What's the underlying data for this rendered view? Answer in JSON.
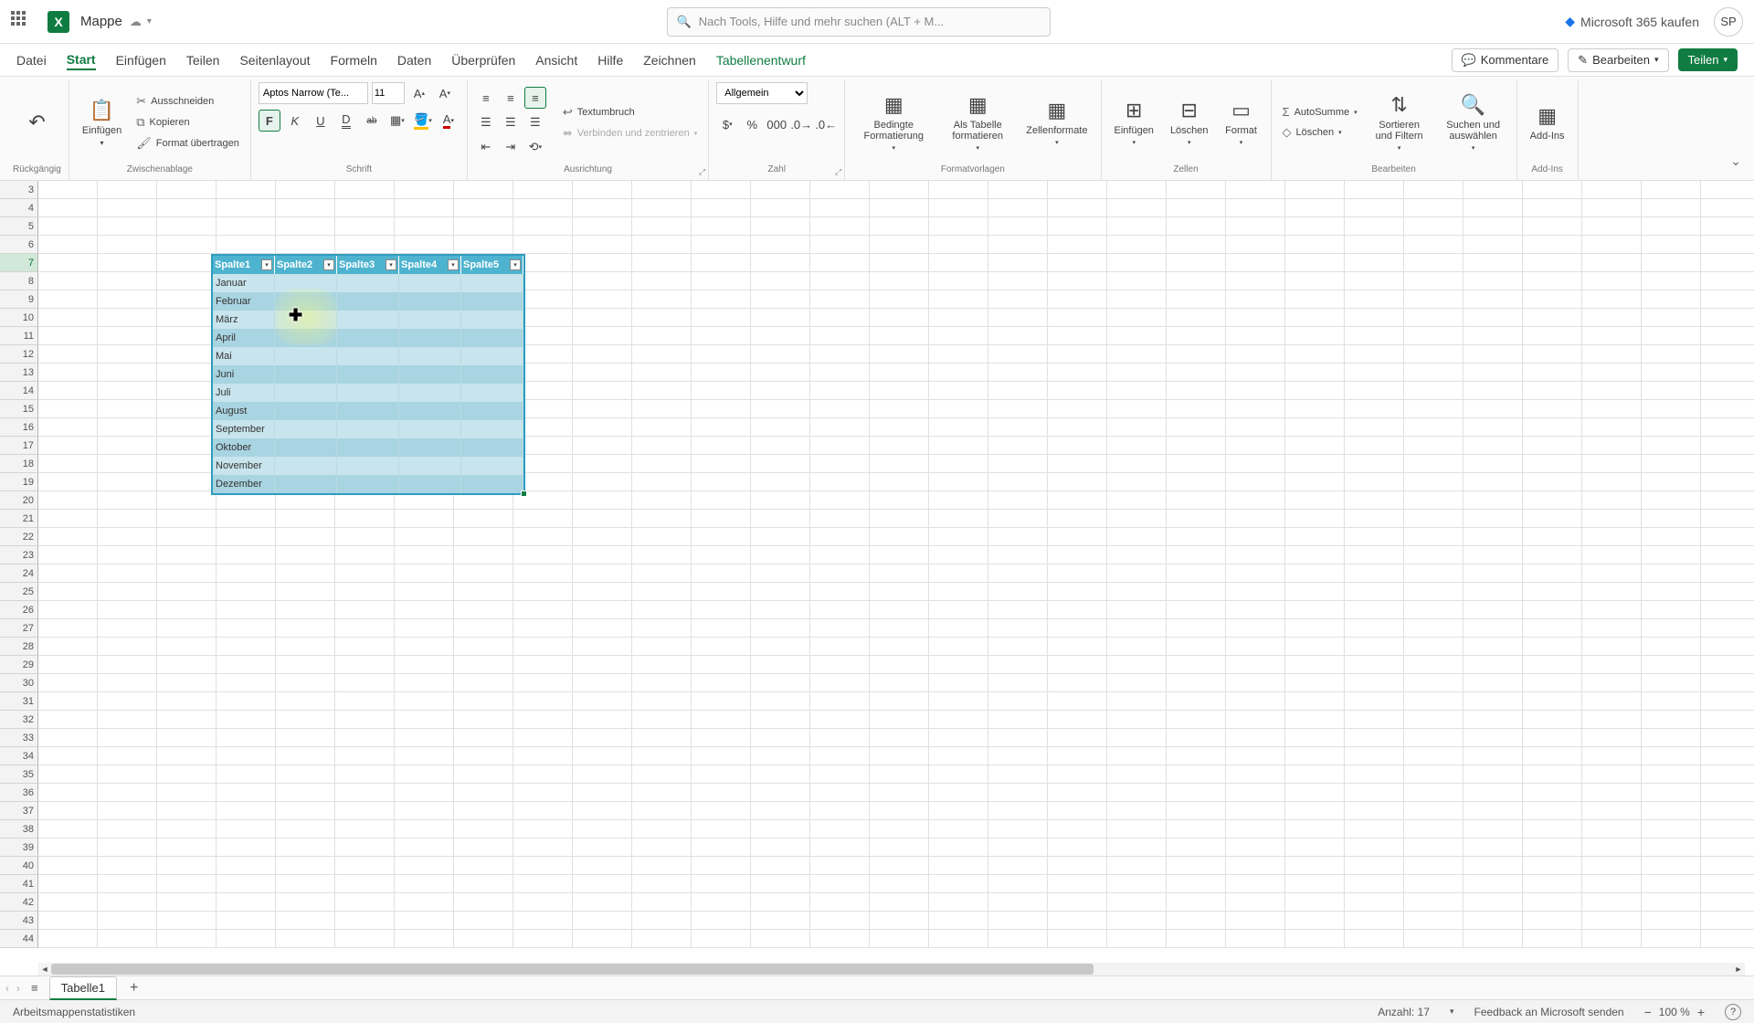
{
  "title": {
    "doc": "Mappe",
    "search_placeholder": "Nach Tools, Hilfe und mehr suchen (ALT + M...",
    "buy": "Microsoft 365 kaufen",
    "avatar": "SP"
  },
  "tabs": {
    "items": [
      "Datei",
      "Start",
      "Einfügen",
      "Teilen",
      "Seitenlayout",
      "Formeln",
      "Daten",
      "Überprüfen",
      "Ansicht",
      "Hilfe",
      "Zeichnen",
      "Tabellenentwurf"
    ],
    "active": 1,
    "context": 11
  },
  "tab_buttons": {
    "comments": "Kommentare",
    "edit": "Bearbeiten",
    "share": "Teilen"
  },
  "ribbon": {
    "undo": "Rückgängig",
    "clipboard": {
      "paste": "Einfügen",
      "cut": "Ausschneiden",
      "copy": "Kopieren",
      "painter": "Format übertragen",
      "label": "Zwischenablage"
    },
    "font": {
      "name": "Aptos Narrow (Te...",
      "size": "11",
      "label": "Schrift"
    },
    "align": {
      "wrap": "Textumbruch",
      "merge": "Verbinden und zentrieren",
      "label": "Ausrichtung"
    },
    "number": {
      "format": "Allgemein",
      "label": "Zahl"
    },
    "styles": {
      "cond": "Bedingte Formatierung",
      "astable": "Als Tabelle formatieren",
      "cellfmt": "Zellenformate",
      "label": "Formatvorlagen"
    },
    "cells": {
      "insert": "Einfügen",
      "delete": "Löschen",
      "format": "Format",
      "label": "Zellen"
    },
    "editing": {
      "autosum": "AutoSumme",
      "clear": "Löschen",
      "sort": "Sortieren und Filtern",
      "find": "Suchen und auswählen",
      "label": "Bearbeiten"
    },
    "addins": {
      "btn": "Add-Ins",
      "label": "Add-Ins"
    }
  },
  "table": {
    "headers": [
      "Spalte1",
      "Spalte2",
      "Spalte3",
      "Spalte4",
      "Spalte5"
    ],
    "rows": [
      "Januar",
      "Februar",
      "März",
      "April",
      "Mai",
      "Juni",
      "Juli",
      "August",
      "September",
      "Oktober",
      "November",
      "Dezember"
    ]
  },
  "row_start": 3,
  "row_selected": 7,
  "sheet": {
    "tab": "Tabelle1"
  },
  "status": {
    "stats": "Arbeitsmappenstatistiken",
    "count_label": "Anzahl:",
    "count_value": "17",
    "feedback": "Feedback an Microsoft senden",
    "zoom": "100 %"
  }
}
